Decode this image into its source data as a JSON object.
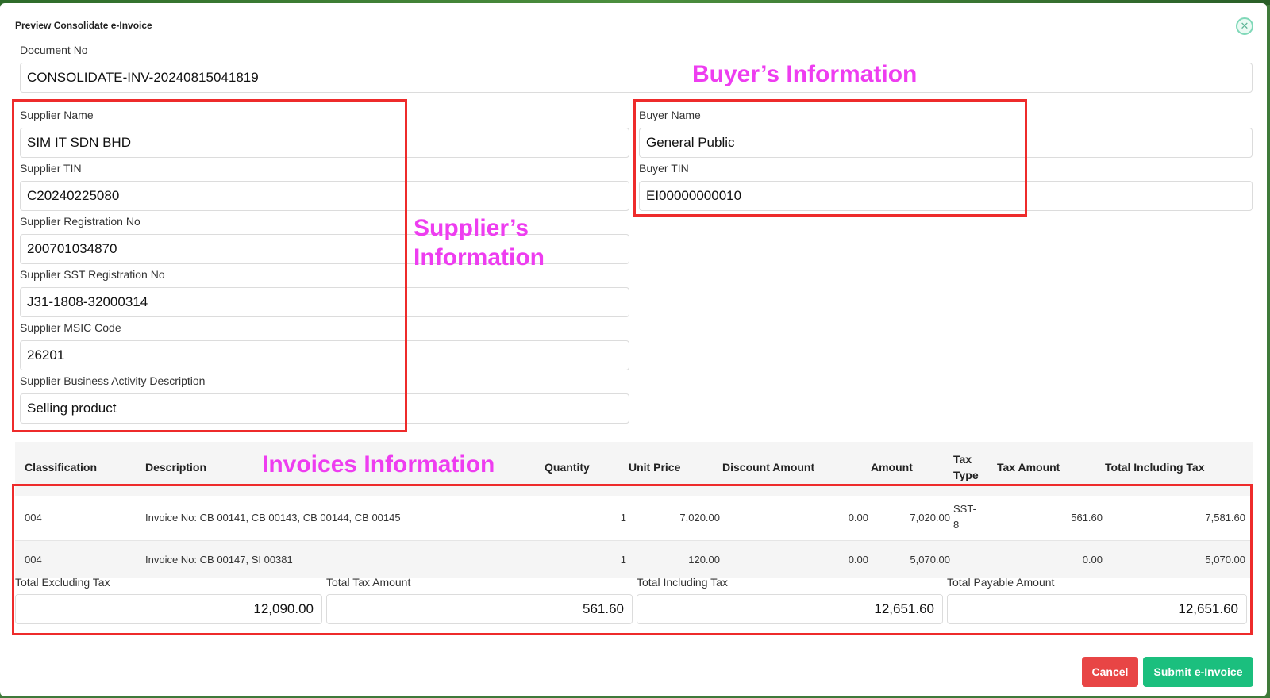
{
  "dialog": {
    "title": "Preview Consolidate e-Invoice"
  },
  "document": {
    "label": "Document No",
    "value": "CONSOLIDATE-INV-20240815041819"
  },
  "supplier": {
    "name_label": "Supplier Name",
    "name": "SIM IT SDN BHD",
    "tin_label": "Supplier TIN",
    "tin": "C20240225080",
    "reg_label": "Supplier Registration No",
    "reg": "200701034870",
    "sst_label": "Supplier SST Registration No",
    "sst": "J31-1808-32000314",
    "msic_label": "Supplier MSIC Code",
    "msic": "26201",
    "activity_label": "Supplier Business Activity Description",
    "activity": "Selling product"
  },
  "buyer": {
    "name_label": "Buyer Name",
    "name": "General Public",
    "tin_label": "Buyer TIN",
    "tin": "EI00000000010"
  },
  "annotations": {
    "buyer": "Buyer’s Information",
    "supplier_line1": "Supplier’s",
    "supplier_line2": "Information",
    "invoices": "Invoices Information"
  },
  "table": {
    "headers": {
      "classification": "Classification",
      "description": "Description",
      "quantity": "Quantity",
      "unit_price": "Unit Price",
      "discount": "Discount Amount",
      "amount": "Amount",
      "tax_type_1": "Tax",
      "tax_type_2": "Type",
      "tax_amount": "Tax Amount",
      "total_incl": "Total Including Tax"
    },
    "rows": [
      {
        "classification": "004",
        "description": "Invoice No: CB 00141, CB 00143, CB 00144, CB 00145",
        "quantity": "1",
        "unit_price": "7,020.00",
        "discount": "0.00",
        "amount": "7,020.00",
        "tax_type_1": "SST-",
        "tax_type_2": "8",
        "tax_amount": "561.60",
        "total_incl": "7,581.60"
      },
      {
        "classification": "004",
        "description": "Invoice No: CB 00147, SI 00381",
        "quantity": "1",
        "unit_price": "120.00",
        "discount": "0.00",
        "amount": "5,070.00",
        "tax_type_1": "",
        "tax_type_2": "",
        "tax_amount": "0.00",
        "total_incl": "5,070.00"
      }
    ]
  },
  "totals": {
    "excl_label": "Total Excluding Tax",
    "excl": "12,090.00",
    "tax_label": "Total Tax Amount",
    "tax": "561.60",
    "incl_label": "Total Including Tax",
    "incl": "12,651.60",
    "payable_label": "Total Payable Amount",
    "payable": "12,651.60"
  },
  "buttons": {
    "cancel": "Cancel",
    "submit": "Submit e-Invoice"
  },
  "colors": {
    "annotation_text": "#ee3df0",
    "annotation_box": "#ee2b2b",
    "cancel": "#e84545",
    "submit": "#1bbf7e"
  }
}
